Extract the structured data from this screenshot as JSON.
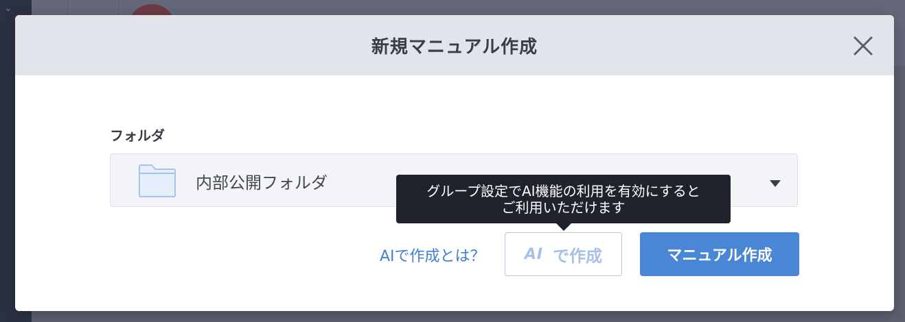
{
  "dialog": {
    "title": "新規マニュアル作成",
    "close_icon": "close-icon"
  },
  "folder_field": {
    "label": "フォルダ",
    "selected_value": "内部公開フォルダ",
    "icon": "folder-icon",
    "dropdown_icon": "caret-down-icon"
  },
  "tooltip": {
    "line1": "グループ設定でAI機能の利用を有効にすると",
    "line2": "ご利用いただけます"
  },
  "actions": {
    "help_link": "AIで作成とは？",
    "ai_badge": "AI",
    "ai_button_label": "で作成",
    "primary_button": "マニュアル作成"
  },
  "colors": {
    "primary": "#4a86d6",
    "link": "#3f7fd6",
    "disabled_ai": "#a8bfe6",
    "tooltip_bg": "#20232b",
    "header_bg": "#e1e4ea"
  }
}
